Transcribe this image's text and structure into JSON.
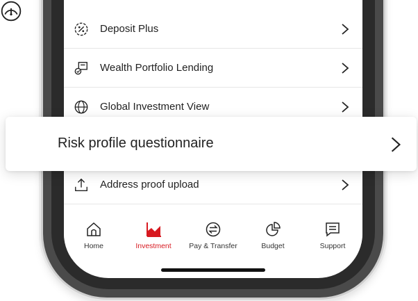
{
  "menu": {
    "items": [
      {
        "label": "Deposit Plus",
        "icon": "percent-badge-icon"
      },
      {
        "label": "Wealth Portfolio Lending",
        "icon": "portfolio-lending-icon"
      },
      {
        "label": "Global Investment View",
        "icon": "globe-icon"
      },
      {
        "label": "Address proof upload",
        "icon": "upload-icon"
      }
    ],
    "highlighted": {
      "label": "Risk profile questionnaire",
      "icon": "speedometer-icon"
    }
  },
  "tabbar": {
    "tabs": [
      {
        "label": "Home",
        "icon": "home-icon"
      },
      {
        "label": "Investment",
        "icon": "investment-chart-icon",
        "active": true
      },
      {
        "label": "Pay & Transfer",
        "icon": "transfer-arrows-icon"
      },
      {
        "label": "Budget",
        "icon": "pie-chart-icon"
      },
      {
        "label": "Support",
        "icon": "chat-icon"
      }
    ]
  },
  "colors": {
    "accent": "#d71920",
    "text": "#222222",
    "divider": "#e6e6e6"
  }
}
